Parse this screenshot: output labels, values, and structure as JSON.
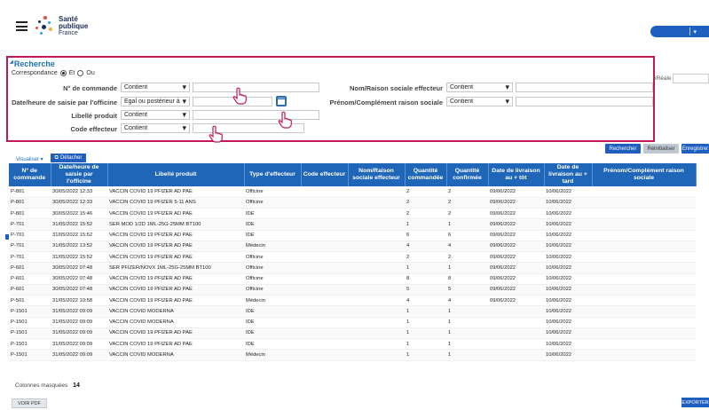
{
  "header": {
    "logo_line1": "Santé",
    "logo_line2": "publique",
    "logo_line3": "France",
    "top_button_caret": "▾"
  },
  "search": {
    "title": "Recherche",
    "correspondance_label": "Correspondance",
    "match_options": [
      "Et",
      "Ou"
    ],
    "match_selected": "Et",
    "fields": {
      "numero_commande": {
        "label": "N° de commande",
        "operator": "Contient",
        "value": ""
      },
      "date_saisie": {
        "label": "Date/heure de saisie par l'officine",
        "operator": "Egal ou postérieur à",
        "value": ""
      },
      "libelle_produit": {
        "label": "Libellé produit",
        "operator": "Contient",
        "value": ""
      },
      "code_effecteur": {
        "label": "Code effecteur",
        "operator": "Contient",
        "value": ""
      },
      "nom_raison_sociale": {
        "label": "Nom/Raison sociale effecteur",
        "operator": "Contient",
        "value": ""
      },
      "prenom_complement": {
        "label": "Prénom/Complément raison sociale",
        "operator": "Contient",
        "value": ""
      }
    },
    "right_fragment_label": "éRéale",
    "buttons": {
      "rechercher": "Rechercher",
      "reinitialiser": "Réinitialiser",
      "enregistrer": "Enregistrer"
    }
  },
  "toolbar": {
    "visualiser": "Visualiser ▾",
    "detacher": "Détacher"
  },
  "table": {
    "columns": [
      "N° de commande",
      "Date/heure de saisie par l'officine",
      "Libellé produit",
      "Type d'effecteur",
      "Code effecteur",
      "Nom/Raison sociale effecteur",
      "Quantité commandée",
      "Quantité confirmée",
      "Date de livraison au + tôt",
      "Date de livraison au + tard",
      "Prénom/Complément raison sociale"
    ],
    "rows": [
      [
        "P-801",
        "30/05/2022 12:33",
        "VACCIN COVID 19 PFIZER AD PAE",
        "Officine",
        "",
        "",
        "2",
        "2",
        "09/06/2022",
        "10/06/2022",
        ""
      ],
      [
        "P-801",
        "30/05/2022 12:33",
        "VACCIN COVID 19 PFIZER 5-11 ANS",
        "Officine",
        "",
        "",
        "2",
        "2",
        "09/06/2022",
        "10/06/2022",
        ""
      ],
      [
        "P-801",
        "30/05/2022 15:46",
        "VACCIN COVID 19 PFIZER AD PAE",
        "IDE",
        "",
        "",
        "2",
        "2",
        "09/06/2022",
        "10/06/2022",
        ""
      ],
      [
        "P-701",
        "31/05/2022 15:52",
        "SER MOD 1/2D 1ML-25G-25MM BT100",
        "IDE",
        "",
        "",
        "1",
        "1",
        "09/06/2022",
        "10/06/2022",
        ""
      ],
      [
        "P-701",
        "31/05/2022 15:52",
        "VACCIN COVID 19 PFIZER AD PAE",
        "IDE",
        "",
        "",
        "6",
        "6",
        "09/06/2022",
        "10/06/2022",
        ""
      ],
      [
        "P-701",
        "31/05/2022 13:52",
        "VACCIN COVID 19 PFIZER AD PAE",
        "Médecin",
        "",
        "",
        "4",
        "4",
        "09/06/2022",
        "10/06/2022",
        ""
      ],
      [
        "P-701",
        "31/05/2022 15:52",
        "VACCIN COVID 19 PFIZER AD PAE",
        "Officine",
        "",
        "",
        "2",
        "2",
        "09/06/2022",
        "10/06/2022",
        ""
      ],
      [
        "P-601",
        "30/05/2022 07:48",
        "SER PFIZER/NOVX 1ML-25G-25MM BT100",
        "Officine",
        "",
        "",
        "1",
        "1",
        "09/06/2022",
        "10/06/2022",
        ""
      ],
      [
        "P-601",
        "30/05/2022 07:48",
        "VACCIN COVID 19 PFIZER AD PAE",
        "Officine",
        "",
        "",
        "8",
        "8",
        "09/06/2022",
        "10/06/2022",
        ""
      ],
      [
        "P-601",
        "30/05/2022 07:48",
        "VACCIN COVID 19 PFIZER AD PAE",
        "Officine",
        "",
        "",
        "5",
        "5",
        "09/06/2022",
        "10/06/2022",
        ""
      ],
      [
        "P-501",
        "31/05/2022 10:58",
        "VACCIN COVID 19 PFIZER AD PAE",
        "Médecin",
        "",
        "",
        "4",
        "4",
        "09/06/2022",
        "10/06/2022",
        ""
      ],
      [
        "P-1501",
        "31/05/2022 09:09",
        "VACCIN COVID MODERNA",
        "IDE",
        "",
        "",
        "1",
        "1",
        "",
        "10/06/2022",
        ""
      ],
      [
        "P-1501",
        "31/05/2022 09:09",
        "VACCIN COVID MODERNA",
        "IDE",
        "",
        "",
        "1",
        "1",
        "",
        "10/06/2022",
        ""
      ],
      [
        "P-1501",
        "31/05/2022 09:09",
        "VACCIN COVID 19 PFIZER AD PAE",
        "IDE",
        "",
        "",
        "1",
        "1",
        "",
        "10/06/2022",
        ""
      ],
      [
        "P-1501",
        "31/05/2022 09:09",
        "VACCIN COVID 19 PFIZER AD PAE",
        "IDE",
        "",
        "",
        "1",
        "1",
        "",
        "10/06/2022",
        ""
      ],
      [
        "P-1501",
        "31/05/2022 09:09",
        "VACCIN COVID MODERNA",
        "Médecin",
        "",
        "",
        "1",
        "1",
        "",
        "10/06/2022",
        ""
      ]
    ]
  },
  "footer": {
    "colonnes_masquees_label": "Colonnes masquées",
    "colonnes_masquees_count": "14",
    "pdf_button": "VOIR PDF",
    "export_button": "EXPORTER"
  },
  "colors": {
    "accent": "#1f5fc0",
    "table_header": "#1f66b8",
    "highlight_border": "#c2185b"
  }
}
